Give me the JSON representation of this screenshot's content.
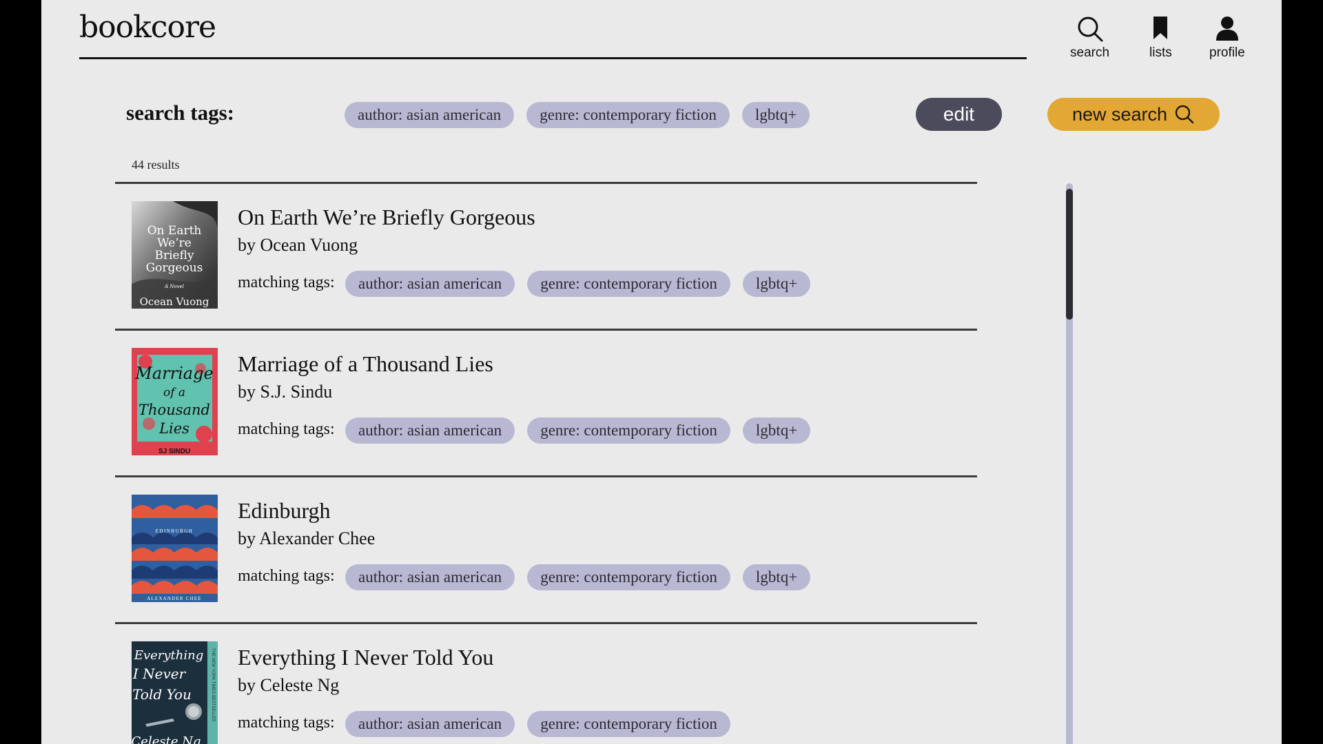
{
  "header": {
    "logo": "bookcore",
    "nav": [
      {
        "label": "search",
        "icon": "search-icon"
      },
      {
        "label": "lists",
        "icon": "bookmark-icon"
      },
      {
        "label": "profile",
        "icon": "user-icon"
      }
    ]
  },
  "search": {
    "label": "search tags:",
    "tags": [
      "author: asian american",
      "genre: contemporary fiction",
      "lgbtq+"
    ],
    "edit_label": "edit",
    "new_search_label": "new search",
    "new_search_icon": "search-icon"
  },
  "results": {
    "count": "44 results",
    "matching_label": "matching tags:",
    "items": [
      {
        "title": "On Earth We’re Briefly Gorgeous",
        "author": "by Ocean Vuong",
        "tags": [
          "author: asian american",
          "genre: contemporary fiction",
          "lgbtq+"
        ],
        "cover_lines": [
          "On Earth",
          "We’re",
          "Briefly",
          "Gorgeous"
        ],
        "cover_sub": "A Novel",
        "cover_author": "Ocean Vuong"
      },
      {
        "title": "Marriage of a Thousand Lies",
        "author": "by S.J. Sindu",
        "tags": [
          "author: asian american",
          "genre: contemporary fiction",
          "lgbtq+"
        ],
        "cover_lines": [
          "Marriage",
          "of a",
          "Thousand",
          "Lies"
        ],
        "cover_author": "SJ SINDU"
      },
      {
        "title": "Edinburgh",
        "author": "by Alexander Chee",
        "tags": [
          "author: asian american",
          "genre: contemporary fiction",
          "lgbtq+"
        ],
        "cover_lines": [
          "EDINBURGH"
        ],
        "cover_author": "ALEXANDER CHEE"
      },
      {
        "title": "Everything I Never Told You",
        "author": "by Celeste Ng",
        "tags": [
          "author: asian american",
          "genre: contemporary fiction"
        ],
        "cover_lines": [
          "Everything",
          "I Never",
          "Told You"
        ],
        "cover_side": "THE NEW YORK TIMES BESTSELLER",
        "cover_author": "Celeste Ng"
      }
    ]
  },
  "colors": {
    "background": "#ebeaeb",
    "tag": "#b9b8d3",
    "edit_button": "#4c4b5b",
    "new_search_button": "#e3a733",
    "text": "#111111"
  }
}
